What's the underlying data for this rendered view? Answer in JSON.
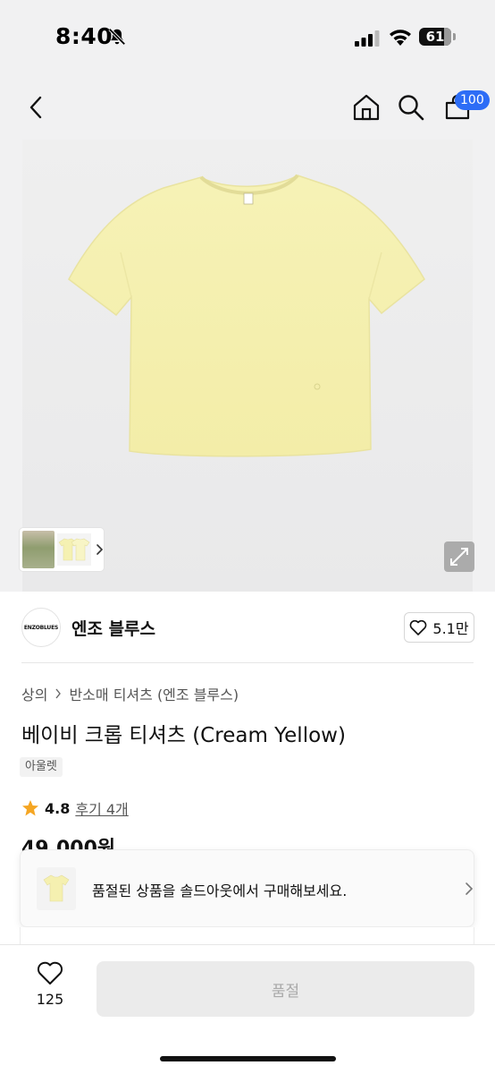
{
  "status_bar": {
    "time": "8:40",
    "battery_level": "61",
    "icons": [
      "bell-off-icon",
      "signal-icon",
      "wifi-icon",
      "battery-icon"
    ]
  },
  "nav": {
    "icons": [
      "back-chevron-icon",
      "home-icon",
      "search-icon",
      "cart-icon"
    ],
    "cart_badge": "100"
  },
  "gallery": {
    "icons": [
      "thumbnail-chevron-icon",
      "expand-icon"
    ]
  },
  "brand": {
    "logo_text": "ENZOBLUES",
    "name": "엔조 블루스",
    "like_count": "5.1만"
  },
  "product": {
    "breadcrumb": [
      "상의",
      "반소매 티셔츠 (엔조 블루스)"
    ],
    "title": "베이비 크롭 티셔츠 (Cream Yellow)",
    "tag": "아울렛",
    "rating": "4.8",
    "review_text": "후기 4개",
    "price": "49,000원"
  },
  "soldout_banner": {
    "text": "품절된 상품을 솔드아웃에서 구매해보세요."
  },
  "bottom_bar": {
    "wish_count": "125",
    "buy_button_label": "품절"
  },
  "colors": {
    "accent_badge": "#2d6df6",
    "shirt": "#f6f2b6",
    "star": "#f5a623",
    "disabled_button": "#ebebeb"
  }
}
